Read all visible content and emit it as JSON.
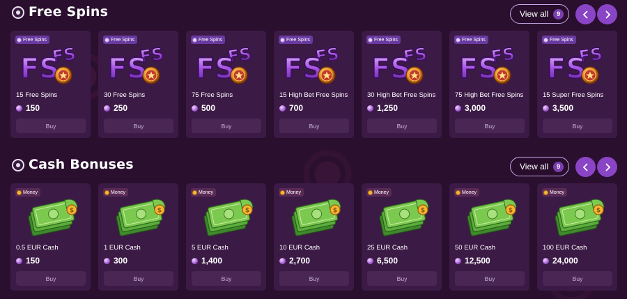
{
  "free_spins": {
    "title": "Free Spins",
    "view_all_label": "View all",
    "view_all_count": "9",
    "cards": [
      {
        "badge": "Free Spins",
        "name": "15 Free Spins",
        "price": "150",
        "buy_label": "Buy"
      },
      {
        "badge": "Free Spins",
        "name": "30 Free Spins",
        "price": "250",
        "buy_label": "Buy"
      },
      {
        "badge": "Free Spins",
        "name": "75 Free Spins",
        "price": "500",
        "buy_label": "Buy"
      },
      {
        "badge": "Free Spins",
        "name": "15 High Bet Free Spins",
        "price": "700",
        "buy_label": "Buy"
      },
      {
        "badge": "Free Spins",
        "name": "30 High Bet Free Spins",
        "price": "1,250",
        "buy_label": "Buy"
      },
      {
        "badge": "Free Spins",
        "name": "75 High Bet Free Spins",
        "price": "3,000",
        "buy_label": "Buy"
      },
      {
        "badge": "Free Spins",
        "name": "15 Super Free Spins",
        "price": "3,500",
        "buy_label": "Buy"
      }
    ]
  },
  "cash_bonuses": {
    "title": "Cash Bonuses",
    "view_all_label": "View all",
    "view_all_count": "9",
    "cards": [
      {
        "badge": "Money",
        "name": "0.5 EUR Cash",
        "price": "150",
        "buy_label": "Buy"
      },
      {
        "badge": "Money",
        "name": "1 EUR Cash",
        "price": "300",
        "buy_label": "Buy"
      },
      {
        "badge": "Money",
        "name": "5 EUR Cash",
        "price": "1,400",
        "buy_label": "Buy"
      },
      {
        "badge": "Money",
        "name": "10 EUR Cash",
        "price": "2,700",
        "buy_label": "Buy"
      },
      {
        "badge": "Money",
        "name": "25 EUR Cash",
        "price": "6,500",
        "buy_label": "Buy"
      },
      {
        "badge": "Money",
        "name": "50 EUR Cash",
        "price": "12,500",
        "buy_label": "Buy"
      },
      {
        "badge": "Money",
        "name": "100 EUR Cash",
        "price": "24,000",
        "buy_label": "Buy"
      }
    ]
  },
  "icons": {
    "section_icon": "chip-icon",
    "prev": "chevron-left-icon",
    "next": "chevron-right-icon",
    "free_spins_art": "fs-coin-icon",
    "cash_art": "money-stack-icon",
    "price_currency": "gem-icon"
  },
  "colors": {
    "background": "#2a0f2e",
    "card": "#3c1a46",
    "accent": "#8a44c6",
    "buy_button": "#4a2654"
  }
}
